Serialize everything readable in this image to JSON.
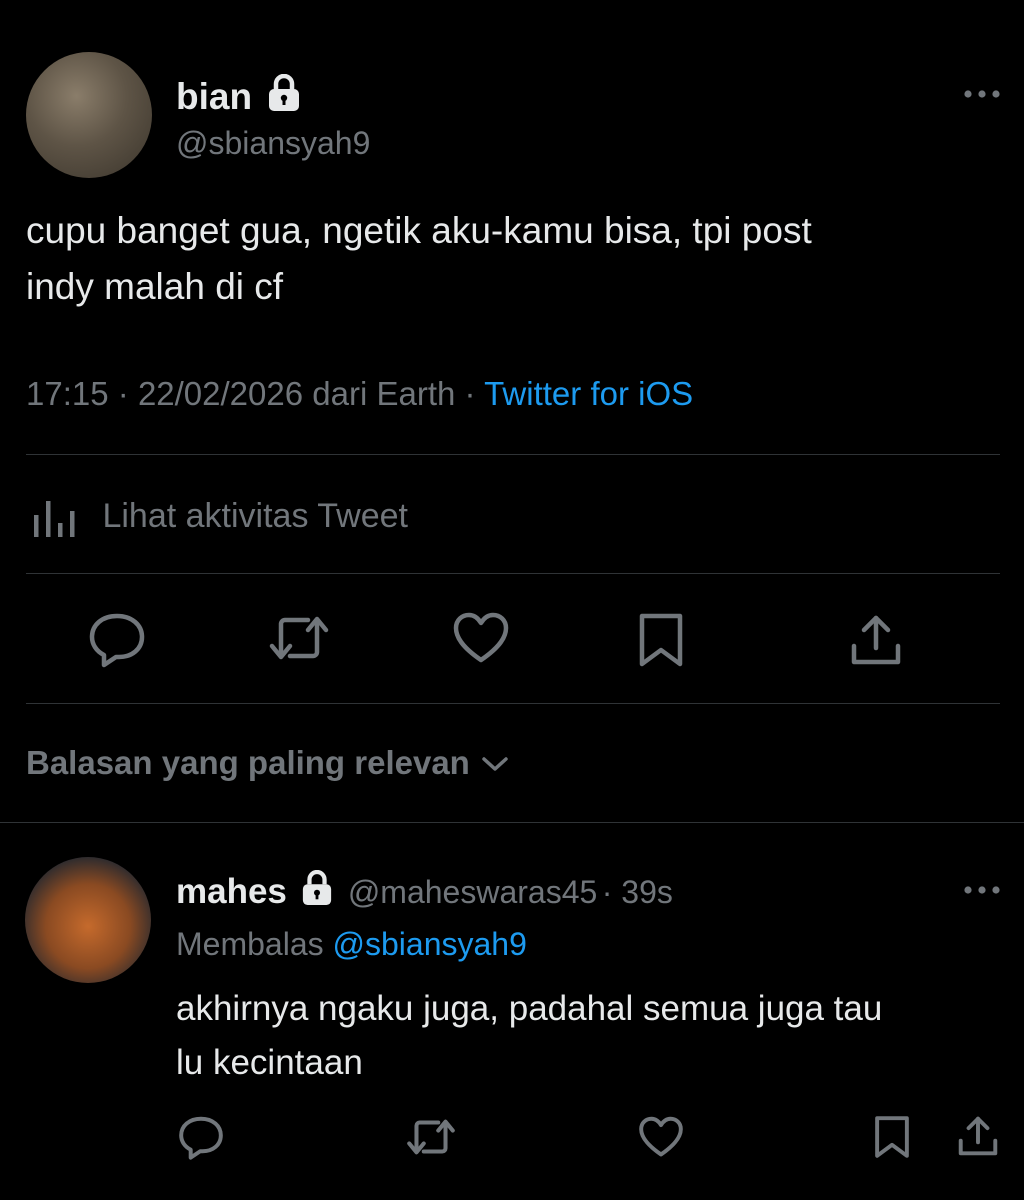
{
  "main_tweet": {
    "author": {
      "display_name": "bian",
      "handle": "@sbiansyah9",
      "protected": true
    },
    "text_line1": "cupu banget gua, ngetik aku-kamu bisa, tpi post",
    "text_line2": "indy malah di cf",
    "meta": {
      "time": "17:15",
      "date": "22/02/2026",
      "location": "dari Earth",
      "source": "Twitter for iOS"
    },
    "activity_label": "Lihat aktivitas Tweet"
  },
  "sort": {
    "label": "Balasan yang paling relevan"
  },
  "reply": {
    "author": {
      "display_name": "mahes",
      "handle": "@maheswaras45",
      "protected": true
    },
    "age": "39s",
    "replying_prefix": "Membalas",
    "replying_to": "@sbiansyah9",
    "text_line1": "akhirnya ngaku juga, padahal semua juga tau",
    "text_line2": "lu kecintaan"
  },
  "icons": {
    "lock": "lock-icon",
    "more": "more-icon",
    "activity": "bar-chart-icon",
    "reply": "reply-icon",
    "retweet": "retweet-icon",
    "like": "heart-icon",
    "bookmark": "bookmark-icon",
    "share": "share-icon",
    "chevron": "chevron-down-icon"
  },
  "colors": {
    "background": "#000000",
    "text_primary": "#e7e9ea",
    "text_secondary": "#71767b",
    "accent": "#1d9bf0",
    "divider": "#2f3336"
  }
}
